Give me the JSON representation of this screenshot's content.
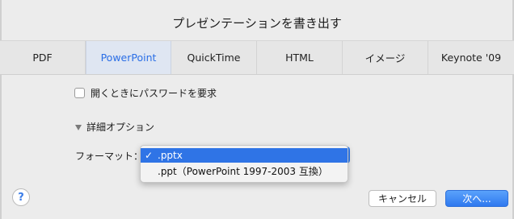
{
  "dialog": {
    "title": "プレゼンテーションを書き出す"
  },
  "tabs": [
    {
      "label": "PDF",
      "active": false
    },
    {
      "label": "PowerPoint",
      "active": true
    },
    {
      "label": "QuickTime",
      "active": false
    },
    {
      "label": "HTML",
      "active": false
    },
    {
      "label": "イメージ",
      "active": false
    },
    {
      "label": "Keynote '09",
      "active": false
    }
  ],
  "options": {
    "password_checkbox_label": "開くときにパスワードを要求",
    "password_checked": false,
    "advanced_label": "詳細オプション",
    "format_label": "フォーマット："
  },
  "format_menu": {
    "items": [
      {
        "label": ".pptx",
        "selected": true,
        "check": "✓"
      },
      {
        "label": ".ppt（PowerPoint 1997-2003 互換）",
        "selected": false,
        "check": ""
      }
    ]
  },
  "footer": {
    "help_label": "?",
    "cancel_label": "キャンセル",
    "next_label": "次へ..."
  },
  "colors": {
    "accent": "#2f74e6",
    "active_tab_text": "#2a6ee6",
    "background": "#ececec"
  }
}
